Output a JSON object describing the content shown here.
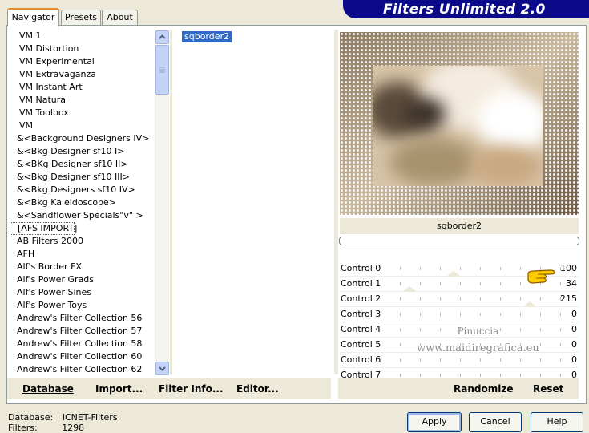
{
  "tabs": [
    "Navigator",
    "Presets",
    "About"
  ],
  "header": {
    "title": "Filters Unlimited 2.0"
  },
  "categories": [
    "VM 1",
    "VM Distortion",
    "VM Experimental",
    "VM Extravaganza",
    "VM Instant Art",
    "VM Natural",
    "VM Toolbox",
    "VM",
    "&<Background Designers IV>",
    "&<Bkg Designer sf10 I>",
    "&<BKg Designer sf10 II>",
    "&<Bkg Designer sf10 III>",
    "&<Bkg Designers sf10 IV>",
    "&<Bkg Kaleidoscope>",
    "&<Sandflower Specials\"v\" >",
    "[AFS IMPORT]",
    "AB Filters 2000",
    "AFH",
    "Alf's Border FX",
    "Alf's Power Grads",
    "Alf's Power Sines",
    "Alf's Power Toys",
    "Andrew's Filter Collection 56",
    "Andrew's Filter Collection 57",
    "Andrew's Filter Collection 58",
    "Andrew's Filter Collection 60",
    "Andrew's Filter Collection 62"
  ],
  "selected_category_index": 15,
  "filters": [
    "sqborder2"
  ],
  "filter_name": "sqborder2",
  "controls": [
    {
      "label": "Control 0",
      "value": "100"
    },
    {
      "label": "Control 1",
      "value": "34"
    },
    {
      "label": "Control 2",
      "value": "215"
    },
    {
      "label": "Control 3",
      "value": "0"
    },
    {
      "label": "Control 4",
      "value": "0"
    },
    {
      "label": "Control 5",
      "value": "0"
    },
    {
      "label": "Control 6",
      "value": "0"
    },
    {
      "label": "Control 7",
      "value": "0"
    }
  ],
  "control_levels": [
    0.39,
    0.13,
    0.84,
    0,
    0,
    0,
    0,
    0
  ],
  "watermark": {
    "line1": "Pinuccia",
    "line2": "www.maidiregrafica.eu"
  },
  "bottom_buttons": {
    "database": "Database",
    "import": "Import...",
    "filter_info": "Filter Info...",
    "editor": "Editor...",
    "randomize": "Randomize",
    "reset": "Reset"
  },
  "status": {
    "database_label": "Database:",
    "database_value": "ICNET-Filters",
    "filters_label": "Filters:",
    "filters_value": "1298"
  },
  "dialog_buttons": {
    "apply": "Apply",
    "cancel": "Cancel",
    "help": "Help"
  },
  "colors": {
    "header_bg": "#0a0a8a",
    "selection": "#316ac5",
    "tab_accent": "#e68b2c"
  }
}
